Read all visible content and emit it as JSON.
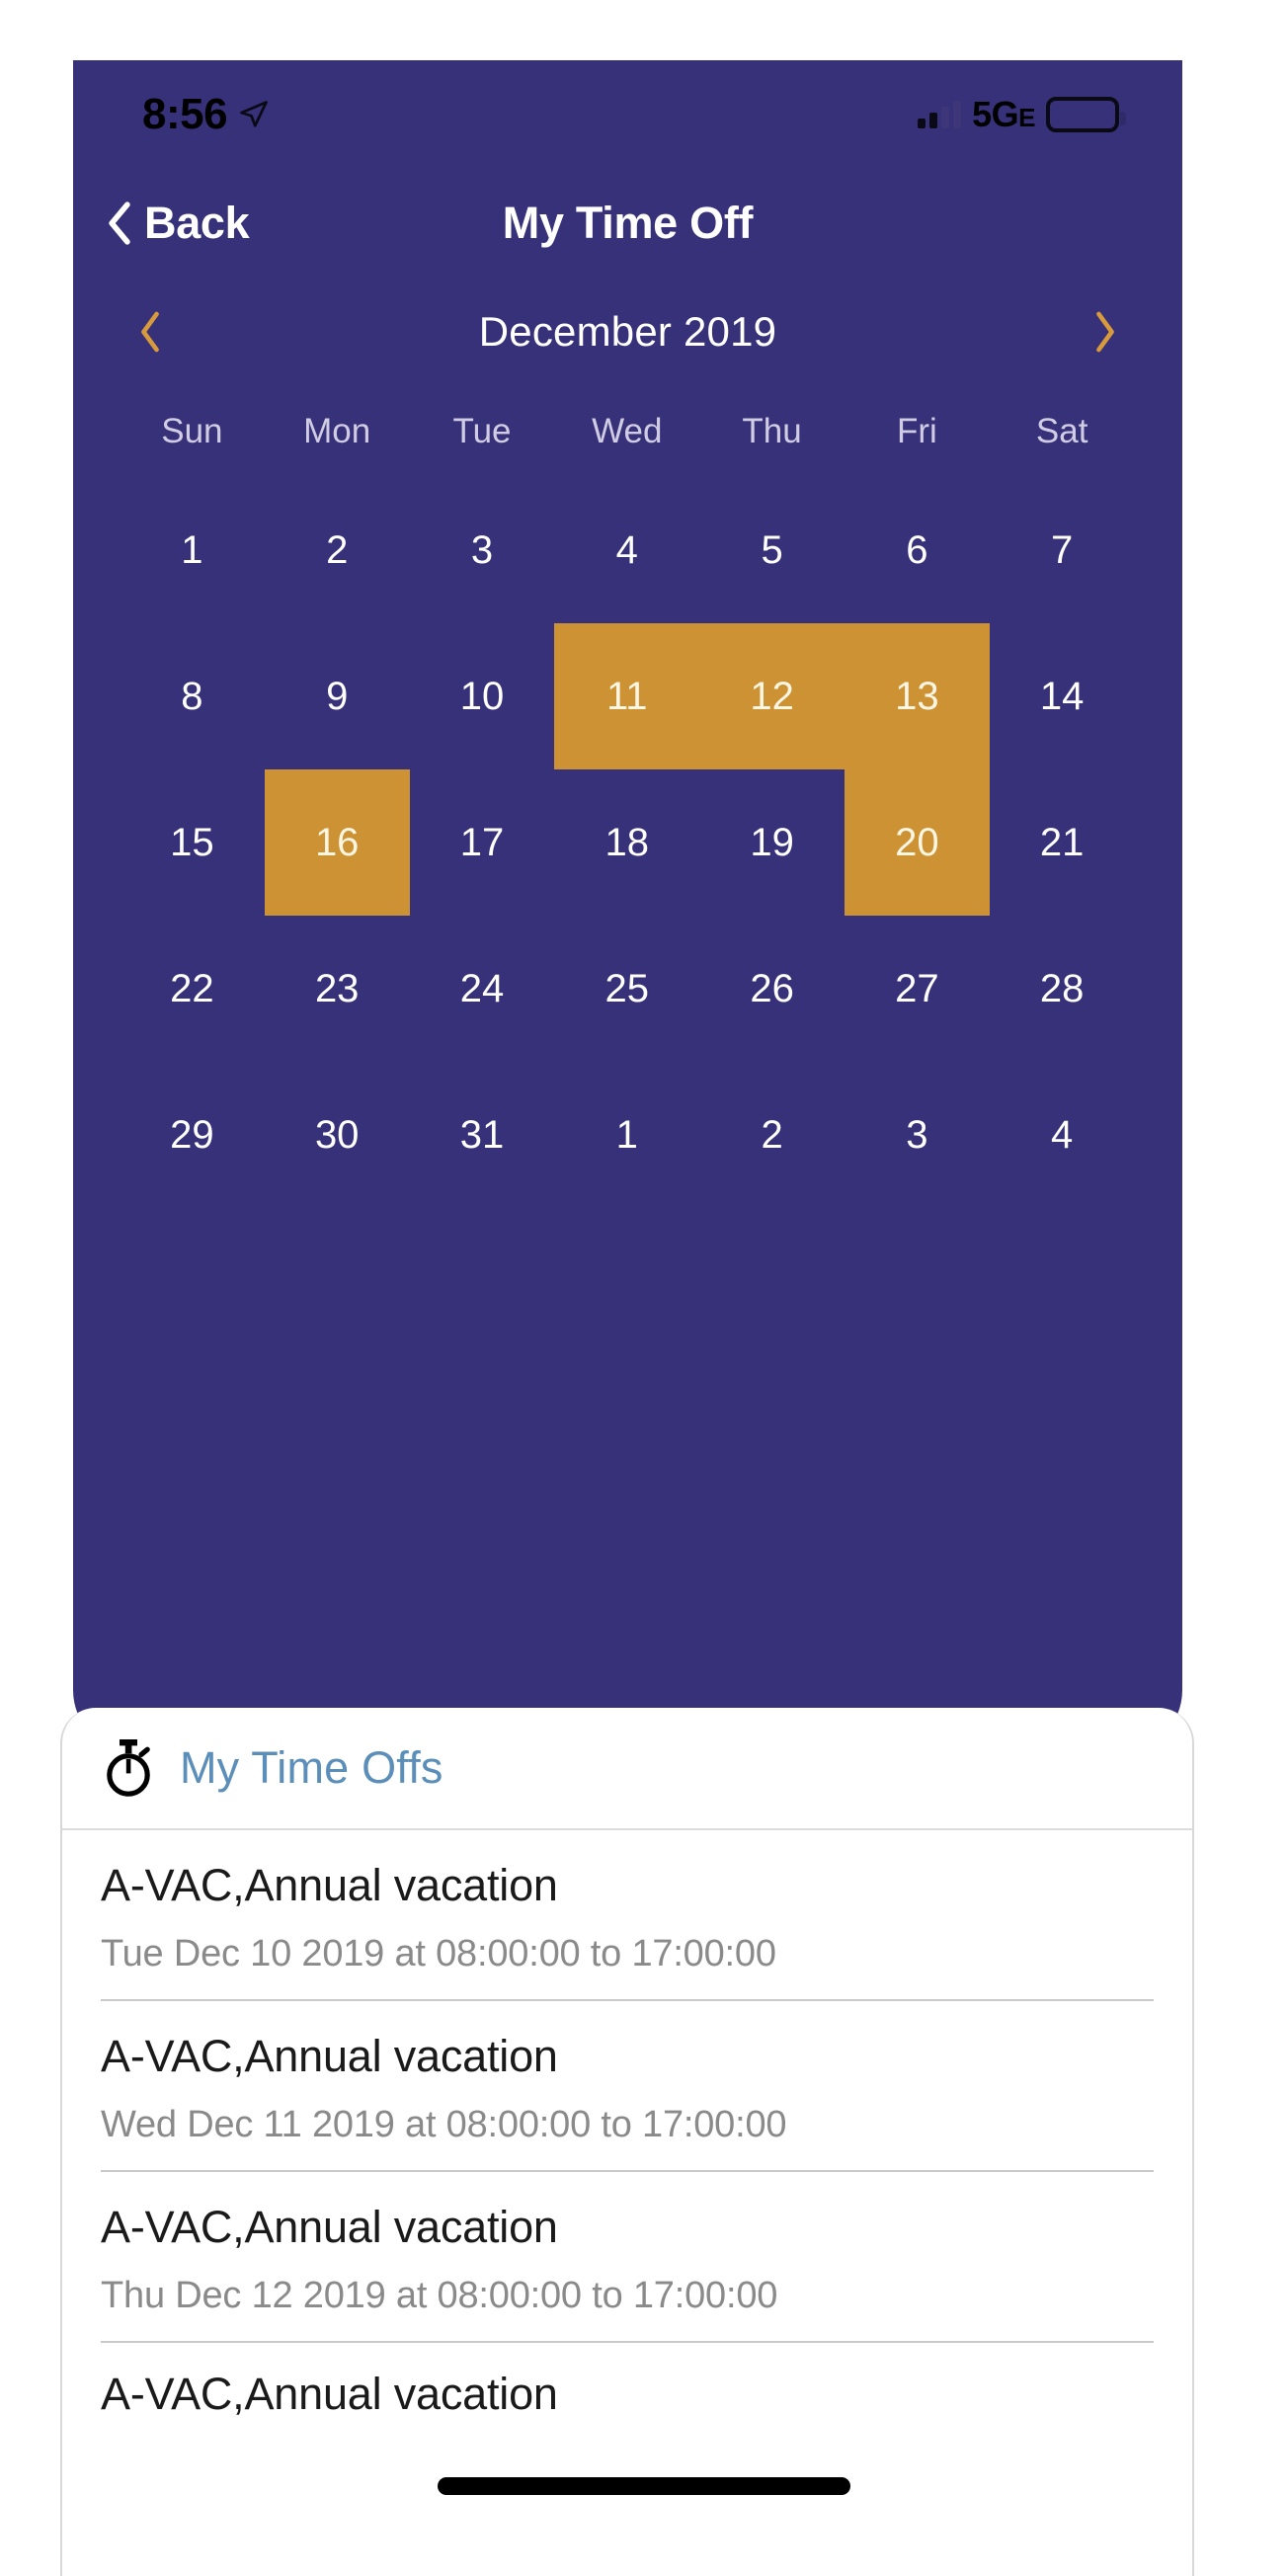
{
  "status_bar": {
    "time": "8:56",
    "location_icon": "location-arrow-icon",
    "network": "5G",
    "network_suffix": "E",
    "battery_icon": "battery-full-icon",
    "signal_icon": "cellular-signal-icon"
  },
  "nav": {
    "back_label": "Back",
    "back_icon": "chevron-left-icon",
    "title": "My Time Off"
  },
  "month_selector": {
    "prev_icon": "chevron-left-icon",
    "next_icon": "chevron-right-icon",
    "label": "December 2019"
  },
  "calendar": {
    "weekdays": [
      "Sun",
      "Mon",
      "Tue",
      "Wed",
      "Thu",
      "Fri",
      "Sat"
    ],
    "weeks": [
      [
        {
          "day": "1",
          "highlighted": false
        },
        {
          "day": "2",
          "highlighted": false
        },
        {
          "day": "3",
          "highlighted": false
        },
        {
          "day": "4",
          "highlighted": false
        },
        {
          "day": "5",
          "highlighted": false
        },
        {
          "day": "6",
          "highlighted": false
        },
        {
          "day": "7",
          "highlighted": false
        }
      ],
      [
        {
          "day": "8",
          "highlighted": false
        },
        {
          "day": "9",
          "highlighted": false
        },
        {
          "day": "10",
          "highlighted": false
        },
        {
          "day": "11",
          "highlighted": true
        },
        {
          "day": "12",
          "highlighted": true
        },
        {
          "day": "13",
          "highlighted": true
        },
        {
          "day": "14",
          "highlighted": false
        }
      ],
      [
        {
          "day": "15",
          "highlighted": false
        },
        {
          "day": "16",
          "highlighted": true
        },
        {
          "day": "17",
          "highlighted": false
        },
        {
          "day": "18",
          "highlighted": false
        },
        {
          "day": "19",
          "highlighted": false
        },
        {
          "day": "20",
          "highlighted": true
        },
        {
          "day": "21",
          "highlighted": false
        }
      ],
      [
        {
          "day": "22",
          "highlighted": false
        },
        {
          "day": "23",
          "highlighted": false
        },
        {
          "day": "24",
          "highlighted": false
        },
        {
          "day": "25",
          "highlighted": false
        },
        {
          "day": "26",
          "highlighted": false
        },
        {
          "day": "27",
          "highlighted": false
        },
        {
          "day": "28",
          "highlighted": false
        }
      ],
      [
        {
          "day": "29",
          "highlighted": false
        },
        {
          "day": "30",
          "highlighted": false
        },
        {
          "day": "31",
          "highlighted": false
        },
        {
          "day": "1",
          "highlighted": false
        },
        {
          "day": "2",
          "highlighted": false
        },
        {
          "day": "3",
          "highlighted": false
        },
        {
          "day": "4",
          "highlighted": false
        }
      ]
    ]
  },
  "sheet": {
    "icon": "stopwatch-icon",
    "title": "My Time Offs",
    "items": [
      {
        "title": "A-VAC,Annual vacation",
        "subtitle": "Tue Dec 10 2019 at 08:00:00 to 17:00:00"
      },
      {
        "title": "A-VAC,Annual vacation",
        "subtitle": "Wed Dec 11 2019 at 08:00:00 to 17:00:00"
      },
      {
        "title": "A-VAC,Annual vacation",
        "subtitle": "Thu Dec 12 2019 at 08:00:00 to 17:00:00"
      },
      {
        "title": "A-VAC,Annual vacation",
        "subtitle": ""
      }
    ]
  },
  "colors": {
    "panel_purple": "#373179",
    "highlight_gold": "#cc9233",
    "arrow_gold": "#d79a3c",
    "sheet_title_blue": "#5b8fb9"
  }
}
